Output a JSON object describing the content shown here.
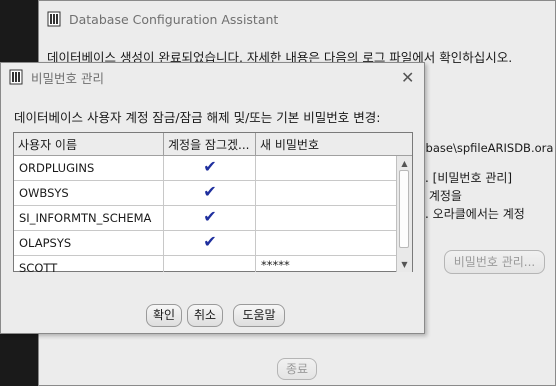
{
  "back_window": {
    "title": "Database Configuration Assistant",
    "message": "데이터베이스 생성이 완료되었습니다. 자세한 내용은 다음의 로그 파일에서 확인하십시오.",
    "line_path": "tabase\\spfileARISDB.ora",
    "line2": "다. [비밀번호 관리]",
    "line3": "스 계정을",
    "line4": "오. 오라클에서는 계정",
    "password_button": "비밀번호 관리...",
    "close_button": "종료"
  },
  "dialog": {
    "title": "비밀번호 관리",
    "instruction": "데이터베이스 사용자 계정 잠금/잠금 해제 및/또는 기본 비밀번호 변경:",
    "columns": [
      "사용자 이름",
      "계정을 잠그겠...",
      "새 비밀번호"
    ],
    "rows": [
      {
        "user": "ORDPLUGINS",
        "locked": "✔",
        "password": ""
      },
      {
        "user": "OWBSYS",
        "locked": "✔",
        "password": ""
      },
      {
        "user": "SI_INFORMTN_SCHEMA",
        "locked": "✔",
        "password": ""
      },
      {
        "user": "OLAPSYS",
        "locked": "✔",
        "password": ""
      },
      {
        "user": "SCOTT",
        "locked": "",
        "password": "*****"
      }
    ],
    "buttons": {
      "ok": "확인",
      "cancel": "취소",
      "help": "도움말"
    }
  },
  "colors": {
    "check": "#1f2f9e",
    "window_bg": "#ececec",
    "desktop": "#1a1a1a"
  }
}
